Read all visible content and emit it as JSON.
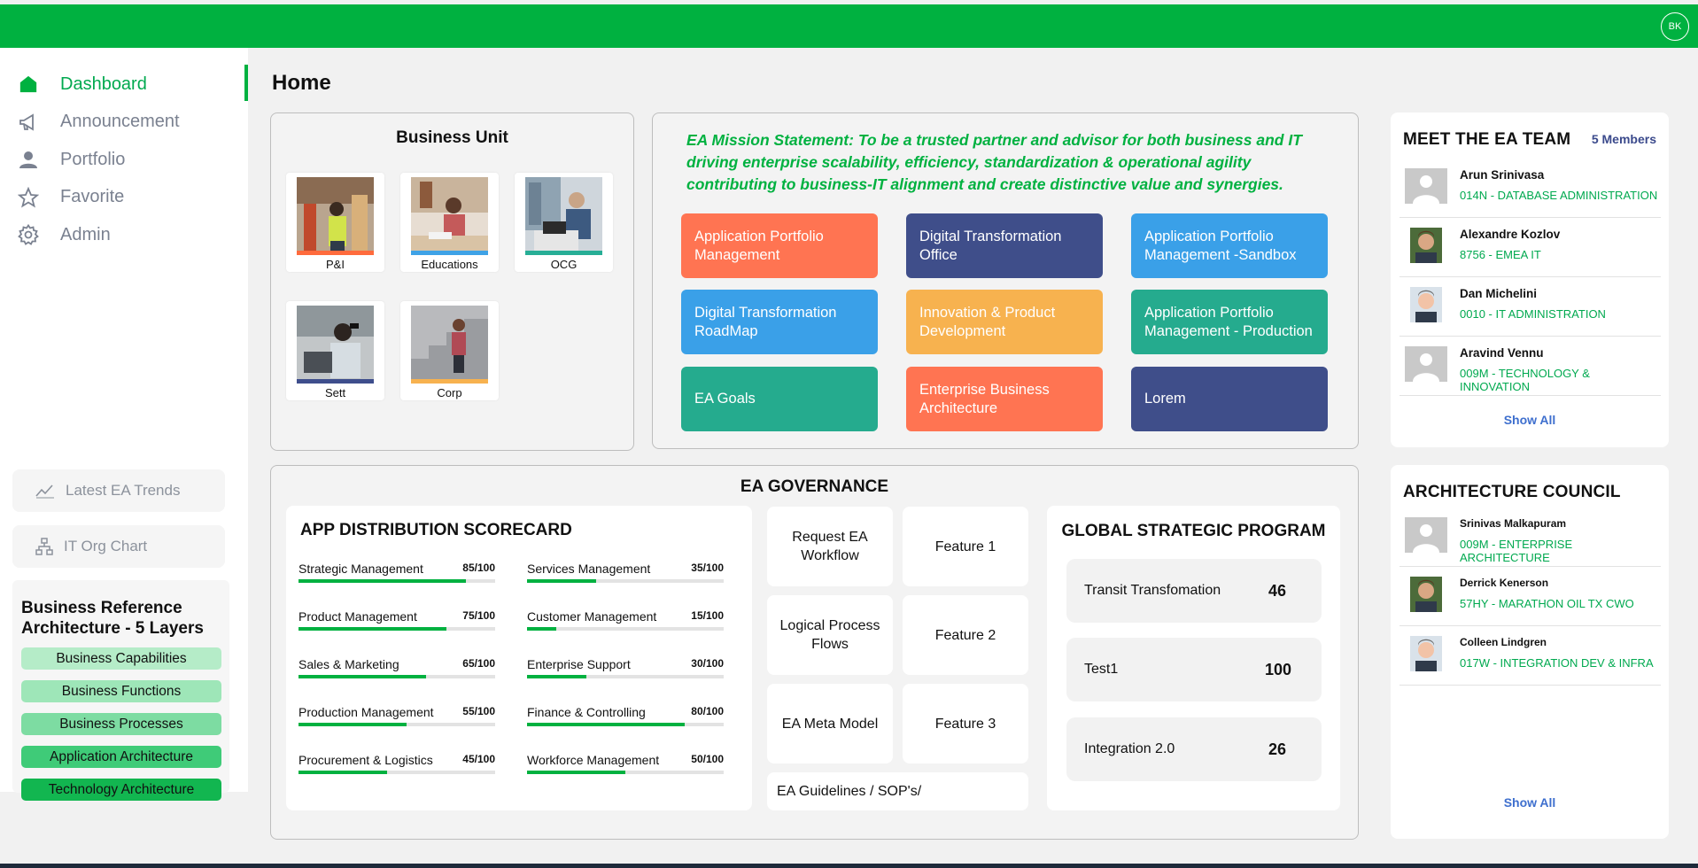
{
  "header": {
    "user_initials": "BK"
  },
  "nav": {
    "items": [
      {
        "label": "Dashboard",
        "icon": "home-icon",
        "active": true
      },
      {
        "label": "Announcement",
        "icon": "megaphone-icon"
      },
      {
        "label": "Portfolio",
        "icon": "user-icon"
      },
      {
        "label": "Favorite",
        "icon": "star-icon"
      },
      {
        "label": "Admin",
        "icon": "gear-icon"
      }
    ],
    "latest_trends": "Latest EA Trends",
    "org_chart": "IT Org Chart"
  },
  "bra": {
    "title": "Business Reference Architecture - 5 Layers",
    "layers": [
      {
        "label": "Business Capabilities",
        "color": "#b5ecc8"
      },
      {
        "label": "Business Functions",
        "color": "#9ee6b8"
      },
      {
        "label": "Business Processes",
        "color": "#7ddca2"
      },
      {
        "label": "Application Architecture",
        "color": "#3fcb78"
      },
      {
        "label": "Technology Architecture",
        "color": "#12b650"
      }
    ]
  },
  "page": {
    "title": "Home"
  },
  "business_unit": {
    "title": "Business Unit",
    "items": [
      {
        "label": "P&I",
        "bar_color": "#ff6b3d"
      },
      {
        "label": "Educations",
        "bar_color": "#3fa2e6"
      },
      {
        "label": "OCG",
        "bar_color": "#27ae96"
      },
      {
        "label": "Sett",
        "bar_color": "#3e4e8c"
      },
      {
        "label": "Corp",
        "bar_color": "#f7b24f"
      }
    ]
  },
  "mission": {
    "text": "EA Mission Statement: To be a trusted partner and advisor for both business and IT driving enterprise scalability, efficiency, standardization & operational agility contributing to business-IT alignment and create distinctive value and synergies."
  },
  "tiles": [
    {
      "label": "Application Portfolio Management",
      "color": "#ff7452"
    },
    {
      "label": "Digital Transformation Office",
      "color": "#3f4e8a"
    },
    {
      "label": "Application Portfolio Management -Sandbox",
      "color": "#3aa0e8"
    },
    {
      "label": "Digital Transformation RoadMap",
      "color": "#3aa0e8"
    },
    {
      "label": "Innovation & Product Development",
      "color": "#f7b24f"
    },
    {
      "label": "Application Portfolio Management - Production",
      "color": "#25ab8e"
    },
    {
      "label": "EA Goals",
      "color": "#25ab8e"
    },
    {
      "label": "Enterprise Business Architecture",
      "color": "#ff7452"
    },
    {
      "label": "Lorem",
      "color": "#3f4e8a"
    }
  ],
  "governance": {
    "title": "EA GOVERNANCE",
    "scorecard": {
      "title": "APP DISTRIBUTION SCORECARD",
      "metrics": [
        {
          "name": "Strategic Management",
          "score": "85/100",
          "value": 85
        },
        {
          "name": "Services Management",
          "score": "35/100",
          "value": 35
        },
        {
          "name": "Product Management",
          "score": "75/100",
          "value": 75
        },
        {
          "name": "Customer Management",
          "score": "15/100",
          "value": 15
        },
        {
          "name": "Sales & Marketing",
          "score": "65/100",
          "value": 65
        },
        {
          "name": "Enterprise Support",
          "score": "30/100",
          "value": 30
        },
        {
          "name": "Production Management",
          "score": "55/100",
          "value": 55
        },
        {
          "name": "Finance & Controlling",
          "score": "80/100",
          "value": 80
        },
        {
          "name": "Procurement & Logistics",
          "score": "45/100",
          "value": 45
        },
        {
          "name": "Workforce Management",
          "score": "50/100",
          "value": 50
        }
      ]
    },
    "workflow": {
      "items": [
        "Request EA Workflow",
        "Feature 1",
        "Logical Process Flows",
        "Feature 2",
        "EA Meta Model",
        "Feature 3"
      ],
      "guidelines": "EA Guidelines / SOP's/"
    },
    "gsp": {
      "title": "GLOBAL STRATEGIC PROGRAM",
      "items": [
        {
          "label": "Transit Transfomation",
          "value": "46"
        },
        {
          "label": "Test1",
          "value": "100"
        },
        {
          "label": "Integration 2.0",
          "value": "26"
        }
      ]
    }
  },
  "team": {
    "title": "MEET THE EA TEAM",
    "count": "5 Members",
    "members": [
      {
        "name": "Arun Srinivasa",
        "dept": "014N - DATABASE ADMINISTRATION",
        "photo": "placeholder"
      },
      {
        "name": "Alexandre Kozlov",
        "dept": "8756 - EMEA IT",
        "photo": "photo"
      },
      {
        "name": "Dan Michelini",
        "dept": "0010 - IT ADMINISTRATION",
        "photo": "photo"
      },
      {
        "name": "Aravind Vennu",
        "dept": "009M - TECHNOLOGY & INNOVATION",
        "photo": "placeholder"
      }
    ],
    "show_all": "Show All"
  },
  "council": {
    "title": "ARCHITECTURE COUNCIL",
    "members": [
      {
        "name": "Srinivas Malkapuram",
        "dept": "009M - ENTERPRISE ARCHITECTURE",
        "photo": "placeholder"
      },
      {
        "name": "Derrick Kenerson",
        "dept": "57HY - MARATHON OIL TX CWO",
        "photo": "photo"
      },
      {
        "name": "Colleen Lindgren",
        "dept": "017W - INTEGRATION DEV & INFRA",
        "photo": "photo"
      }
    ],
    "show_all": "Show All"
  }
}
